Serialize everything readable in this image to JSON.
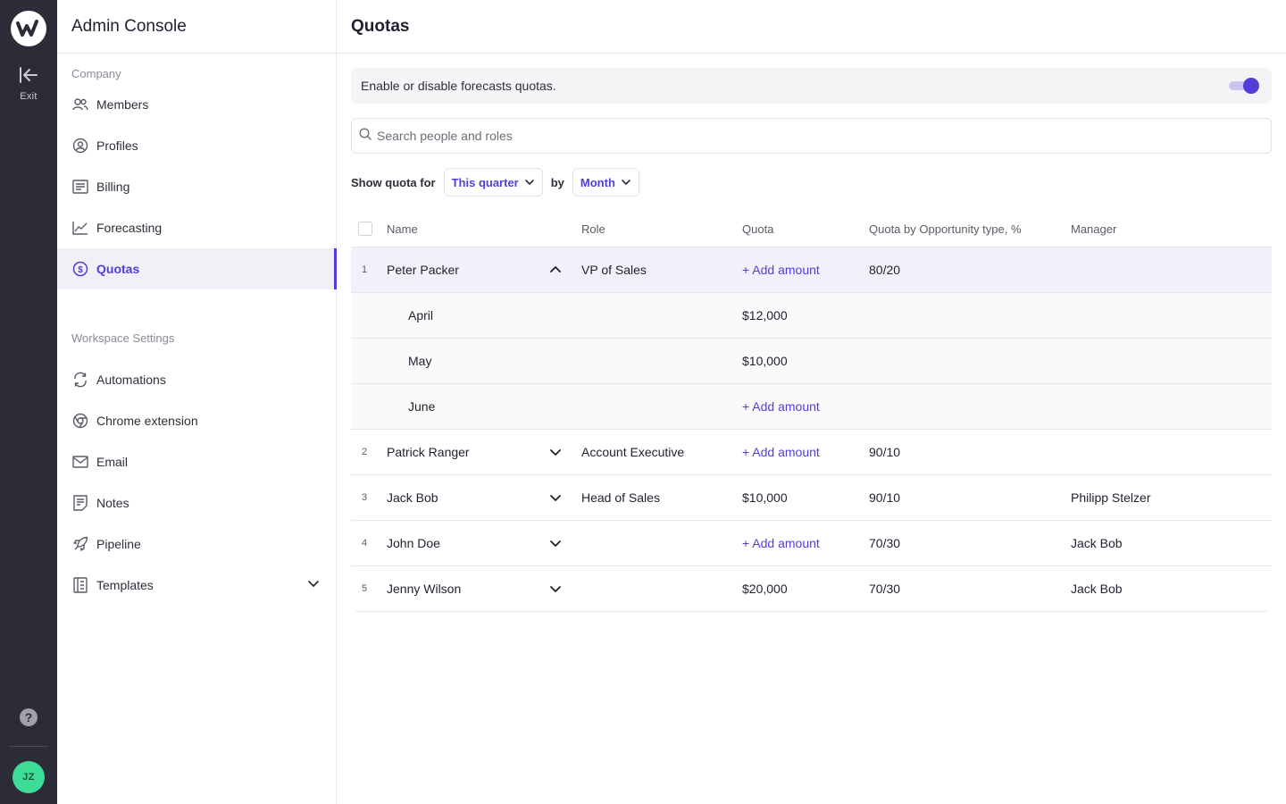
{
  "rail": {
    "exit_label": "Exit",
    "avatar_initials": "JZ",
    "help_glyph": "?"
  },
  "sidebar": {
    "title": "Admin Console",
    "company_label": "Company",
    "company_items": [
      {
        "label": "Members",
        "icon": "users-icon"
      },
      {
        "label": "Profiles",
        "icon": "user-circle-icon"
      },
      {
        "label": "Billing",
        "icon": "receipt-icon"
      },
      {
        "label": "Forecasting",
        "icon": "chart-line-icon"
      },
      {
        "label": "Quotas",
        "icon": "dollar-circle-icon",
        "active": true
      }
    ],
    "workspace_label": "Workspace Settings",
    "workspace_items": [
      {
        "label": "Automations",
        "icon": "refresh-icon"
      },
      {
        "label": "Chrome extension",
        "icon": "chrome-icon"
      },
      {
        "label": "Email",
        "icon": "mail-icon"
      },
      {
        "label": "Notes",
        "icon": "note-icon"
      },
      {
        "label": "Pipeline",
        "icon": "rocket-icon"
      },
      {
        "label": "Templates",
        "icon": "template-icon"
      }
    ]
  },
  "main": {
    "title": "Quotas",
    "toggle_text": "Enable or disable forecasts quotas.",
    "toggle_on": true,
    "search_placeholder": "Search people and roles",
    "filter": {
      "show_label": "Show quota for",
      "period_value": "This quarter",
      "by_label": "by",
      "granularity_value": "Month"
    },
    "table": {
      "headers": {
        "name": "Name",
        "role": "Role",
        "quota": "Quota",
        "type": "Quota by Opportunity type, %",
        "manager": "Manager"
      },
      "add_label": "+ Add amount",
      "rows": [
        {
          "num": "1",
          "name": "Peter Packer",
          "role": "VP of Sales",
          "quota": "+ Add amount",
          "type": "80/20",
          "manager": ""
        },
        {
          "num": "2",
          "name": "Patrick Ranger",
          "role": "Account Executive",
          "quota": "+ Add amount",
          "type": "90/10",
          "manager": ""
        },
        {
          "num": "3",
          "name": "Jack Bob",
          "role": "Head of Sales",
          "quota": "$10,000",
          "type": "90/10",
          "manager": "Philipp Stelzer"
        },
        {
          "num": "4",
          "name": "John Doe",
          "role": "",
          "quota": "+ Add amount",
          "type": "70/30",
          "manager": "Jack Bob"
        },
        {
          "num": "5",
          "name": "Jenny Wilson",
          "role": "",
          "quota": "$20,000",
          "type": "70/30",
          "manager": "Jack Bob"
        }
      ],
      "sub_rows": [
        {
          "name": "April",
          "quota": "$12,000"
        },
        {
          "name": "May",
          "quota": "$10,000"
        },
        {
          "name": "June",
          "quota": "+ Add amount"
        }
      ]
    }
  },
  "colors": {
    "accent": "#4f3fd8",
    "rail_bg": "#2b2c38",
    "avatar_bg": "#3ddc97"
  }
}
